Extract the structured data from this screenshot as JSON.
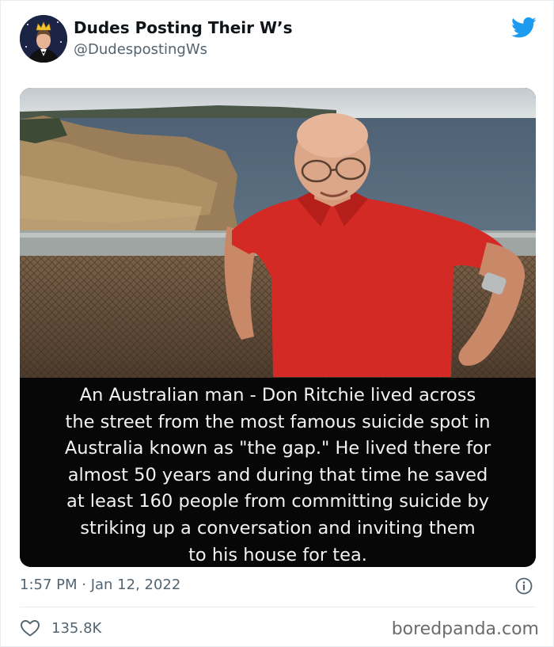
{
  "tweet": {
    "author_name": "Dudes Posting Their W’s",
    "author_handle": "@DudespostingWs",
    "timestamp": "1:57 PM · Jan 12, 2022",
    "likes": "135.8K"
  },
  "image": {
    "caption_lines": [
      "An Australian man - Don Ritchie lived across",
      "the street from the most famous suicide spot in",
      "Australia known as \"the gap.\" He lived there for",
      "almost 50 years and during that time he saved",
      "at least 160 people from committing suicide by",
      "striking up a conversation and inviting them",
      "to his house for tea."
    ]
  },
  "watermark": "boredpanda.com",
  "colors": {
    "twitter_blue": "#1d9bf0",
    "shirt_red": "#d42a25",
    "caption_bg": "#070707",
    "muted_text": "#536471"
  },
  "icons": {
    "brand": "twitter-bird-icon",
    "info": "info-icon",
    "like": "heart-icon"
  }
}
